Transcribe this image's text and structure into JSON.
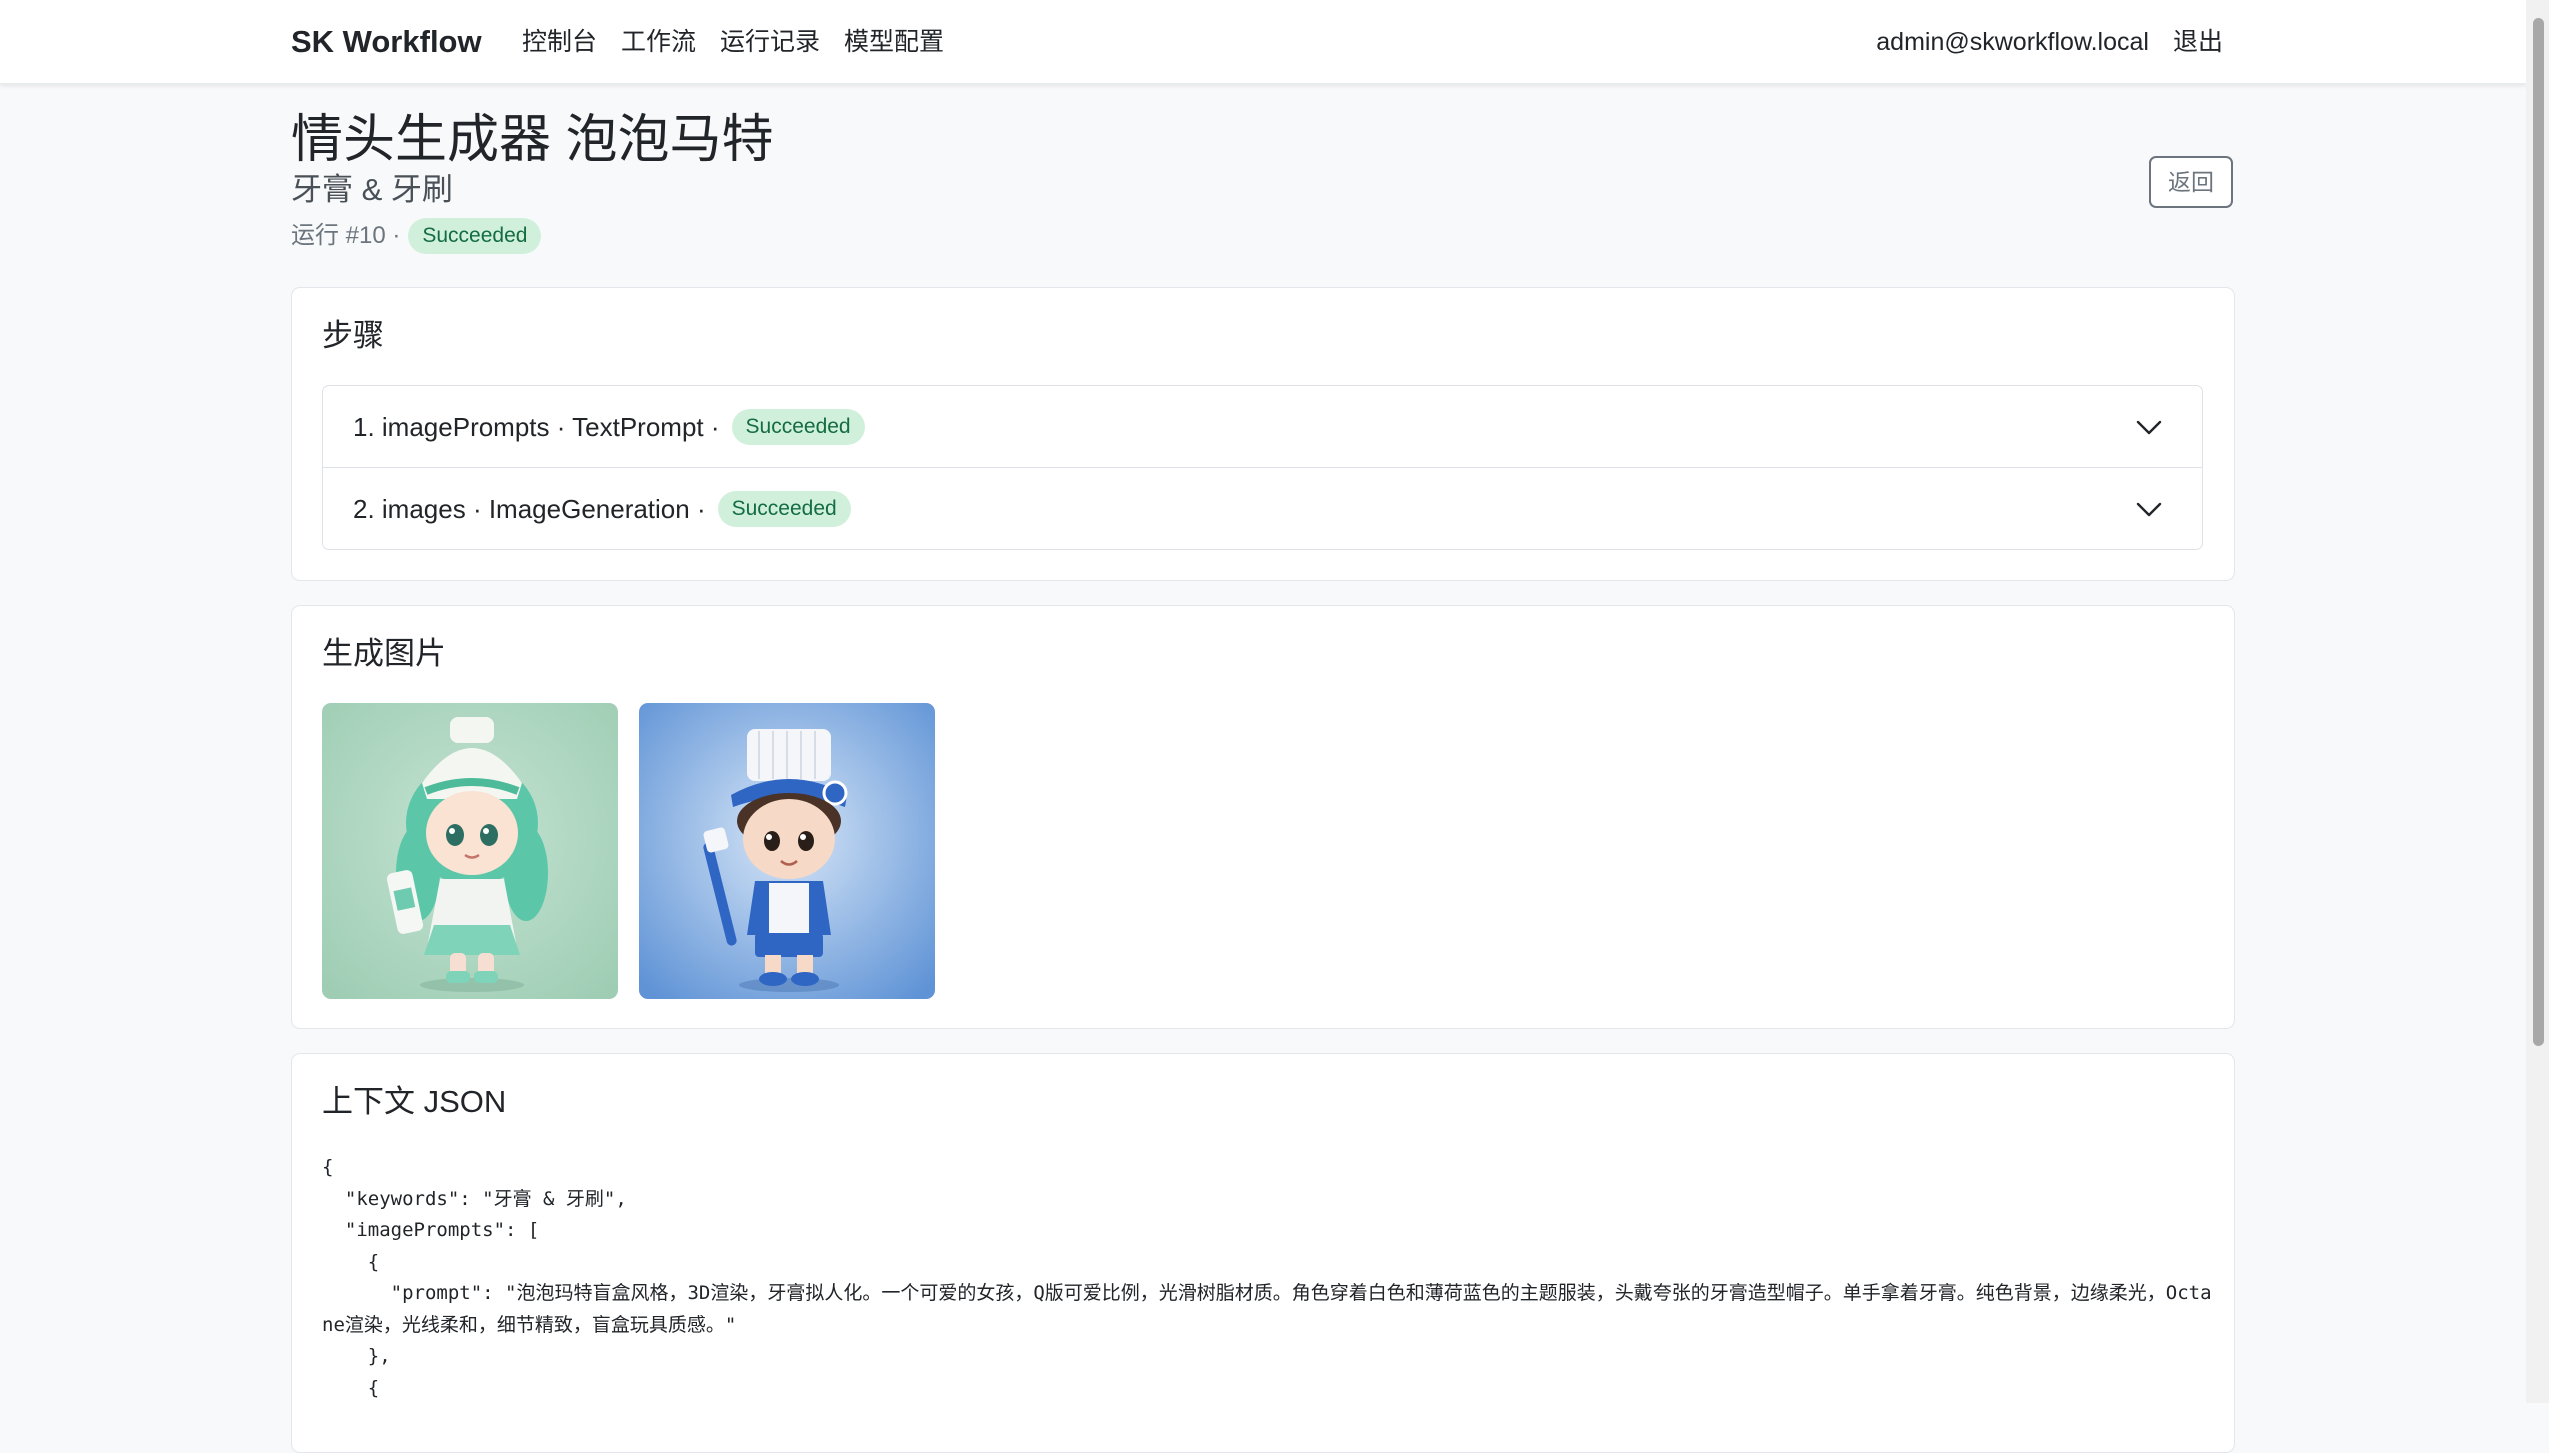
{
  "nav": {
    "brand": "SK Workflow",
    "links": [
      "控制台",
      "工作流",
      "运行记录",
      "模型配置"
    ],
    "user_email": "admin@skworkflow.local",
    "logout": "退出"
  },
  "header": {
    "title": "情头生成器 泡泡马特",
    "subtitle": "牙膏 & 牙刷",
    "run_label": "运行 #10 ·",
    "status": "Succeeded",
    "back_button": "返回"
  },
  "steps": {
    "title": "步骤",
    "items": [
      {
        "label": "1. imagePrompts · TextPrompt ·",
        "status": "Succeeded"
      },
      {
        "label": "2. images · ImageGeneration ·",
        "status": "Succeeded"
      }
    ]
  },
  "images": {
    "title": "生成图片",
    "items": [
      {
        "description": "mint-green toothpaste girl figurine",
        "bg": "#a9d4bd"
      },
      {
        "description": "blue toothbrush boy figurine",
        "bg": "#5f93d6"
      }
    ]
  },
  "context": {
    "title": "上下文 JSON",
    "json_text": "{\n  \"keywords\": \"牙膏 & 牙刷\",\n  \"imagePrompts\": [\n    {\n      \"prompt\": \"泡泡玛特盲盒风格，3D渲染，牙膏拟人化。一个可爱的女孩，Q版可爱比例，光滑树脂材质。角色穿着白色和薄荷蓝色的主题服装，头戴夸张的牙膏造型帽子。单手拿着牙膏。纯色背景，边缘柔光，Octane渲染，光线柔和，细节精致，盲盒玩具质感。\"\n    },\n    {"
  },
  "colors": {
    "badge_bg": "#d1f0dc",
    "badge_text": "#146c43",
    "page_bg": "#f8f9fa"
  }
}
